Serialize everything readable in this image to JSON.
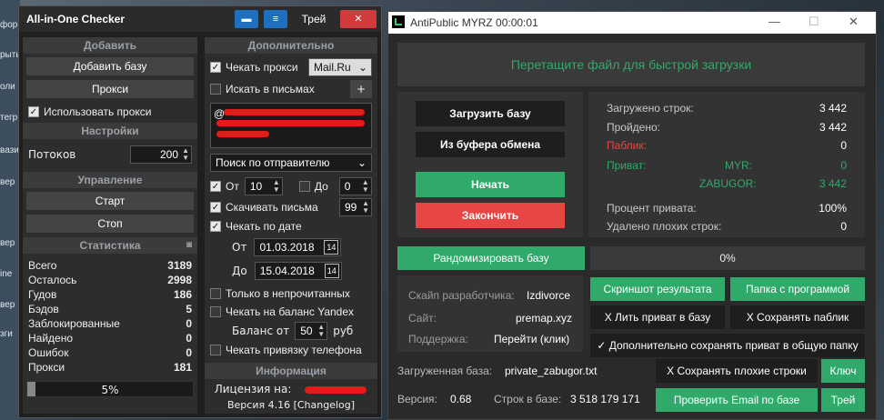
{
  "left_edge": [
    "форм",
    "рыть",
    "оли",
    "тегр",
    "вази",
    "вер",
    "вер",
    "ine",
    "вер",
    "зги"
  ],
  "checker": {
    "title": "All-in-One Checker",
    "lang_button": "Трей",
    "close": "✕",
    "add_section": "Добавить",
    "add_base": "Добавить базу",
    "proxy": "Прокси",
    "use_proxy": "Использовать прокси",
    "settings_section": "Настройки",
    "threads_label": "Потоков",
    "threads_value": "200",
    "control_section": "Управление",
    "start": "Старт",
    "stop": "Стоп",
    "stats_section": "Статистика",
    "stats": [
      {
        "label": "Всего",
        "value": "3189"
      },
      {
        "label": "Осталось",
        "value": "2998"
      },
      {
        "label": "Гудов",
        "value": "186"
      },
      {
        "label": "Бэдов",
        "value": "5"
      },
      {
        "label": "Заблокированные",
        "value": "0"
      },
      {
        "label": "Найдено",
        "value": "0"
      },
      {
        "label": "Ошибок",
        "value": "0"
      },
      {
        "label": "Прокси",
        "value": "181"
      }
    ],
    "progress_text": "5%",
    "progress": 0.05,
    "extra_section": "Дополнительно",
    "check_proxy": "Чекать прокси",
    "proxy_select": "Mail.Ru",
    "search_letters": "Искать в письмах",
    "plus": "+",
    "email_prefix": "@",
    "search_mode": "Поиск по отправителю",
    "from_label": "От",
    "from_value": "10",
    "to_label": "До",
    "to_value": "0",
    "download_letters": "Скачивать письма",
    "download_value": "99",
    "check_by_date": "Чекать по дате",
    "date_from_label": "От",
    "date_from": "01.03.2018",
    "date_to_label": "До",
    "date_to": "15.04.2018",
    "only_unread": "Только в непрочитанных",
    "check_yandex": "Чекать на баланс Yandex",
    "balance_label": "Баланс от",
    "balance_value": "50",
    "balance_unit": "руб",
    "check_phone": "Чекать привязку телефона",
    "info_section": "Информация",
    "license_label": "Лицензия на:",
    "version": "Версия 4.16 [Changelog]"
  },
  "antipublic": {
    "title": "AntiPublic MYRZ 00:00:01",
    "min": "—",
    "max": "☐",
    "close": "✕",
    "drop_text": "Перетащите файл для быстрой загрузки",
    "load_base": "Загрузить базу",
    "from_clipboard": "Из буфера обмена",
    "start": "Начать",
    "finish": "Закончить",
    "stats": {
      "loaded_label": "Загружено строк:",
      "loaded": "3 442",
      "passed_label": "Пройдено:",
      "passed": "3 442",
      "public_label": "Паблик:",
      "public": "0",
      "private_label": "Приват:",
      "myr_label": "MYR:",
      "myr": "0",
      "zabugor_label": "ZABUGOR:",
      "zabugor": "3 442",
      "percent_label": "Процент привата:",
      "percent": "100%",
      "deleted_label": "Удалено плохих строк:",
      "deleted": "0"
    },
    "randomize": "Рандомизировать базу",
    "progress_text": "0%",
    "progress": 0,
    "dev_skype_label": "Скайп разработчика:",
    "dev_skype": "Izdivorce",
    "site_label": "Сайт:",
    "site": "premap.xyz",
    "support_label": "Поддержка:",
    "support": "Перейти (клик)",
    "screenshot": "Скриншот результата",
    "program_folder": "Папка с программой",
    "pour_private": "Х Лить приват в базу",
    "save_public": "Х Сохранять паблик",
    "save_private_common": "✓ Дополнительно сохранять приват в общую папку",
    "loaded_base_label": "Загруженная база:",
    "loaded_base": "private_zabugor.txt",
    "save_bad": "Х Сохранять плохие строки",
    "key": "Ключ",
    "version_label": "Версия:",
    "version": "0.68",
    "lines_label": "Строк в базе:",
    "lines": "3 518 179 171",
    "check_email": "Проверить Email по базе",
    "tray": "Трей"
  },
  "colors": {
    "green": "#2faa6a",
    "red": "#e84545",
    "blue": "#1f6fbf"
  }
}
